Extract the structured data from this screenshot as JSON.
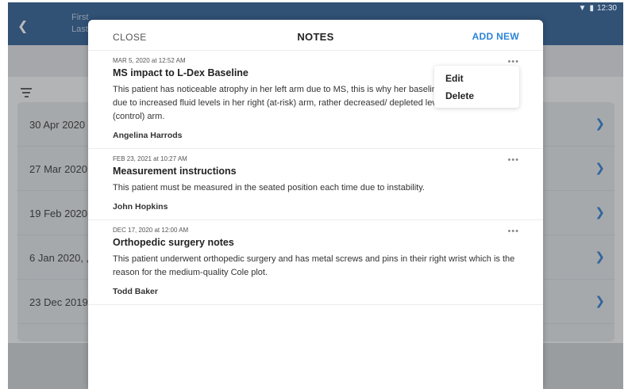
{
  "status": {
    "time": "12:30"
  },
  "app": {
    "patient_names": [
      "First",
      "Last"
    ],
    "list": [
      {
        "date": "30 Apr 2020"
      },
      {
        "date": "27 Mar 2020"
      },
      {
        "date": "19 Feb 2020,"
      },
      {
        "date": "6 Jan 2020, ,"
      },
      {
        "date": "23 Dec 2019"
      }
    ]
  },
  "modal": {
    "close_label": "CLOSE",
    "title": "NOTES",
    "add_label": "ADD NEW",
    "notes": [
      {
        "timestamp": "MAR 5, 2020 at 12:52 AM",
        "title": "MS impact to L-Dex Baseline",
        "body": "This patient has noticeable atrophy in her left arm due to MS, this is why her baseline was +15. It is not due to increased fluid levels in her right (at-risk) arm, rather decreased/ depleted levels of fluid in her left (control) arm.",
        "author": "Angelina Harrods"
      },
      {
        "timestamp": "FEB 23, 2021 at 10:27 AM",
        "title": "Measurement instructions",
        "body": "This patient must be measured in the seated position each time due to instability.",
        "author": "John Hopkins"
      },
      {
        "timestamp": "DEC 17, 2020 at 12:00 AM",
        "title": "Orthopedic surgery notes",
        "body": "This patient underwent orthopedic surgery and has metal screws and pins in their right wrist which is the reason for the medium-quality Cole plot.",
        "author": "Todd Baker"
      }
    ],
    "context_menu": {
      "edit_label": "Edit",
      "delete_label": "Delete"
    }
  },
  "colors": {
    "appbar": "#2b5c94",
    "accent": "#2b84d8"
  }
}
